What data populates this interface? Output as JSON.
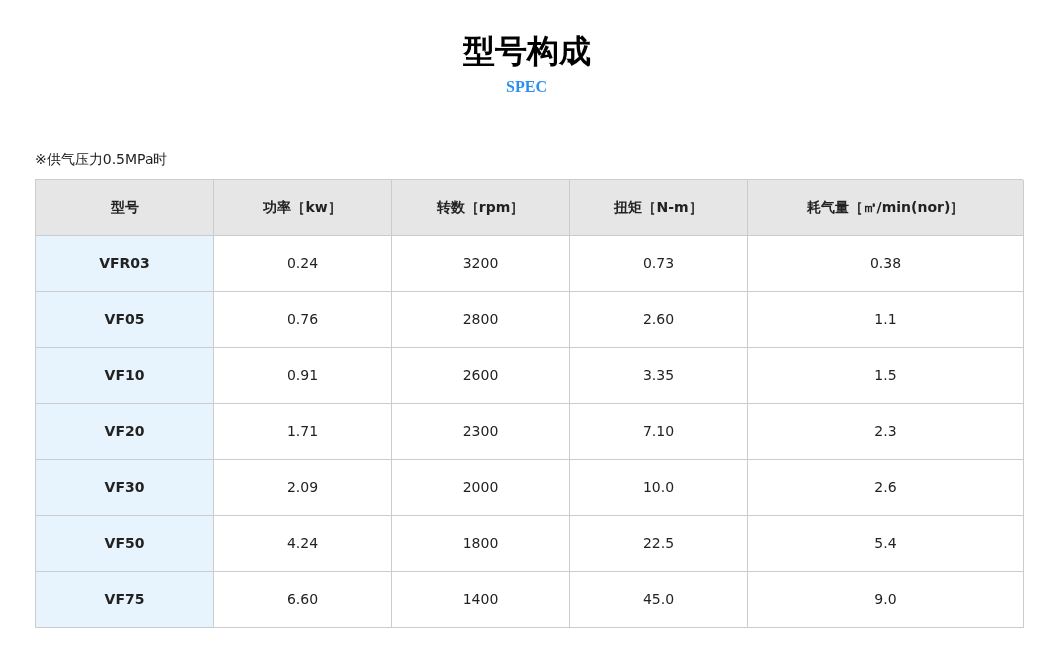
{
  "title": "型号构成",
  "subtitle": "SPEC",
  "note": "※供气压力0.5MPa时",
  "table": {
    "columns": [
      "型号",
      "功率［kw］",
      "转数［rpm］",
      "扭矩［N-m］",
      "耗气量［㎥/min(nor)］"
    ],
    "rows": [
      [
        "VFR03",
        "0.24",
        "3200",
        "0.73",
        "0.38"
      ],
      [
        "VF05",
        "0.76",
        "2800",
        "2.60",
        "1.1"
      ],
      [
        "VF10",
        "0.91",
        "2600",
        "3.35",
        "1.5"
      ],
      [
        "VF20",
        "1.71",
        "2300",
        "7.10",
        "2.3"
      ],
      [
        "VF30",
        "2.09",
        "2000",
        "10.0",
        "2.6"
      ],
      [
        "VF50",
        "4.24",
        "1800",
        "22.5",
        "5.4"
      ],
      [
        "VF75",
        "6.60",
        "1400",
        "45.0",
        "9.0"
      ]
    ]
  }
}
